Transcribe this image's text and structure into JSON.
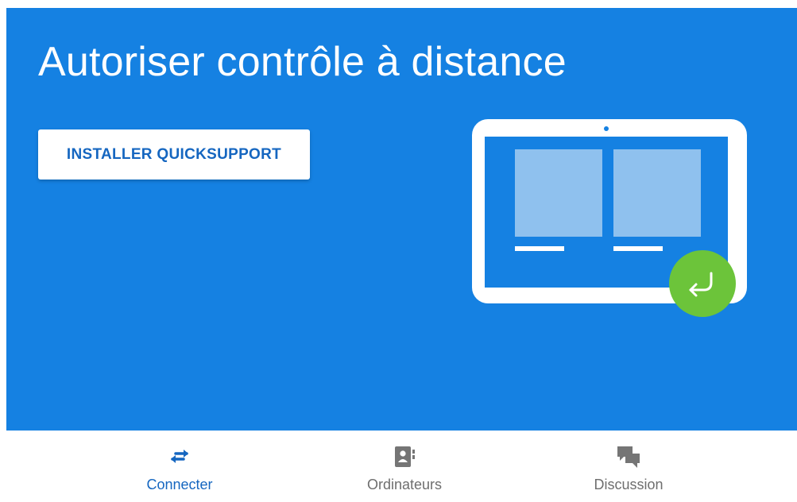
{
  "hero": {
    "title": "Autoriser contrôle à distance",
    "install_button_label": "INSTALLER QUICKSUPPORT"
  },
  "bottom_nav": {
    "items": [
      {
        "label": "Connecter",
        "icon": "swap-arrows-icon",
        "active": true
      },
      {
        "label": "Ordinateurs",
        "icon": "contacts-book-icon",
        "active": false
      },
      {
        "label": "Discussion",
        "icon": "chat-bubbles-icon",
        "active": false
      }
    ]
  },
  "colors": {
    "hero_background": "#1581e2",
    "accent_blue": "#1566c0",
    "fab_green": "#6cc43a",
    "inactive_icon": "#757575"
  }
}
